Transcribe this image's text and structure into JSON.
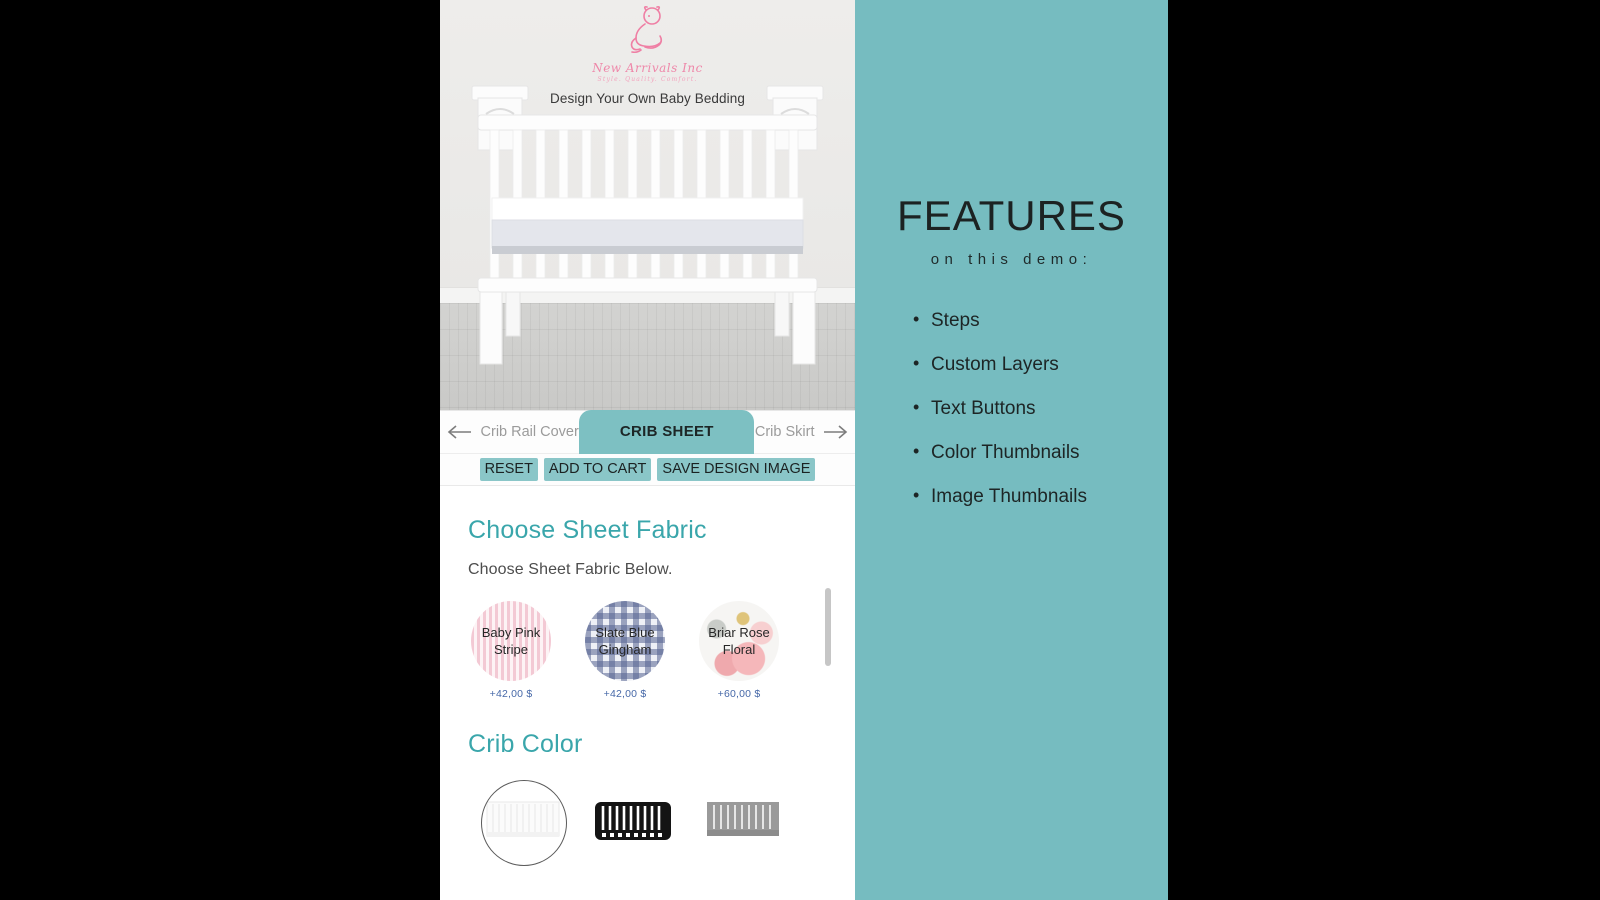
{
  "brand": {
    "logo_icon": "baby-bear-logo-icon",
    "script_name": "New Arrivals Inc",
    "tagline_small": "Style. Quality. Comfort.",
    "hero_tagline": "Design Your Own Baby Bedding"
  },
  "preview": {
    "image_name": "white-crib-nursery-preview"
  },
  "steps": {
    "prev_arrow": "←",
    "next_arrow": "→",
    "items": [
      {
        "label": "Crib Rail Cover",
        "active": false
      },
      {
        "label": "CRIB SHEET",
        "active": true
      },
      {
        "label": "Crib Skirt",
        "active": false
      }
    ]
  },
  "actions": {
    "reset": "RESET",
    "add_to_cart": "ADD TO CART",
    "save_design_image": "SAVE DESIGN IMAGE"
  },
  "fabric_section": {
    "title": "Choose Sheet Fabric",
    "subtitle": "Choose Sheet Fabric Below.",
    "options": [
      {
        "label": "Baby Pink Stripe",
        "price": "+42,00 $",
        "swatch": "pink-stripe-swatch"
      },
      {
        "label": "Slate Blue Gingham",
        "price": "+42,00 $",
        "swatch": "slate-blue-gingham-swatch"
      },
      {
        "label": "Briar Rose Floral",
        "price": "+60,00 $",
        "swatch": "briar-rose-floral-swatch"
      }
    ]
  },
  "color_section": {
    "title": "Crib Color",
    "options": [
      {
        "name": "white-crib-thumbnail",
        "selected": true
      },
      {
        "name": "black-crib-thumbnail",
        "selected": false
      },
      {
        "name": "gray-crib-thumbnail",
        "selected": false
      }
    ]
  },
  "features": {
    "title": "FEATURES",
    "subtitle": "on this demo:",
    "items": [
      "Steps",
      "Custom Layers",
      "Text Buttons",
      "Color Thumbnails",
      "Image Thumbnails"
    ]
  },
  "colors": {
    "teal_panel": "#76bcc0",
    "accent_teal": "#7dc0c2",
    "heading_teal": "#3aa6ab",
    "price_blue": "#4668a8",
    "logo_pink": "#ef7fa4"
  }
}
